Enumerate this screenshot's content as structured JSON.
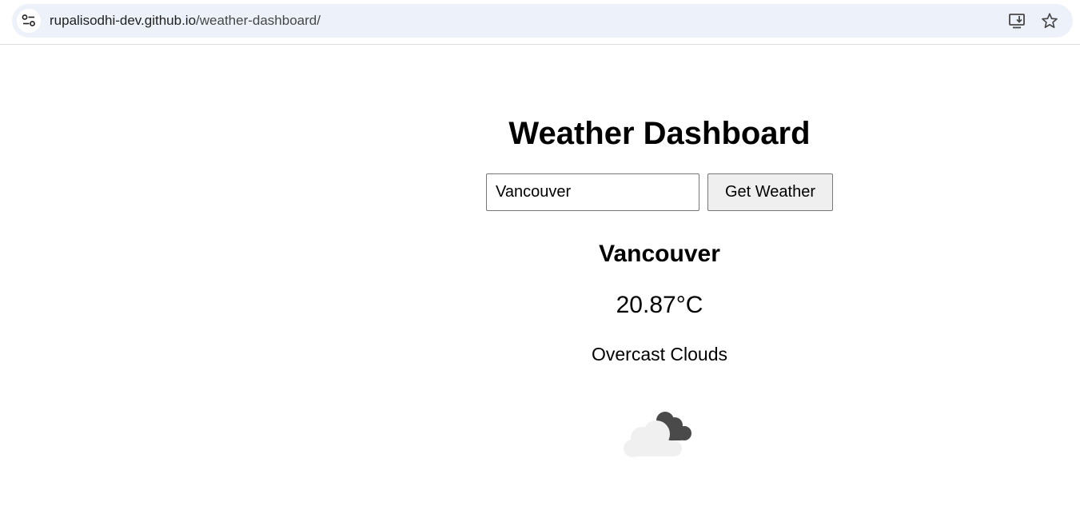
{
  "browser": {
    "url_host": "rupalisodhi-dev.github.io",
    "url_path": "/weather-dashboard/"
  },
  "page": {
    "title": "Weather Dashboard",
    "search": {
      "value": "Vancouver",
      "button_label": "Get Weather"
    },
    "result": {
      "city": "Vancouver",
      "temperature": "20.87°C",
      "description": "Overcast Clouds",
      "icon": "overcast-clouds-icon"
    }
  }
}
